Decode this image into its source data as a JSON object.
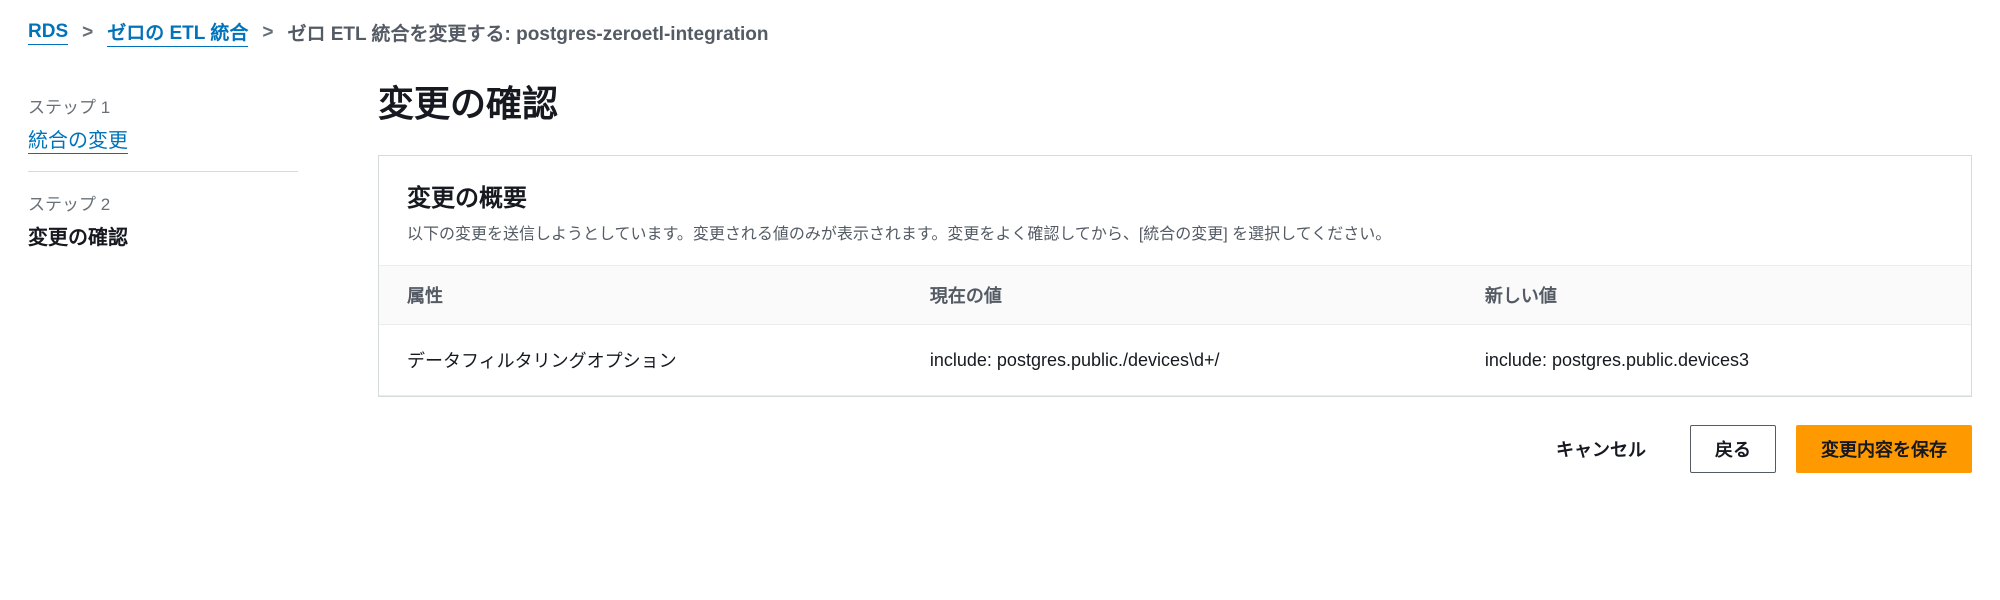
{
  "breadcrumb": {
    "items": [
      {
        "label": "RDS",
        "link": true
      },
      {
        "label": "ゼロの ETL 統合",
        "link": true
      },
      {
        "label": "ゼロ ETL 統合を変更する: postgres-zeroetl-integration",
        "link": false
      }
    ],
    "separator": ">"
  },
  "sidebar": {
    "steps": [
      {
        "label": "ステップ 1",
        "title": "統合の変更",
        "current": false
      },
      {
        "label": "ステップ 2",
        "title": "変更の確認",
        "current": true
      }
    ]
  },
  "main": {
    "title": "変更の確認",
    "panel": {
      "title": "変更の概要",
      "description": "以下の変更を送信しようとしています。変更される値のみが表示されます。変更をよく確認してから、[統合の変更] を選択してください。"
    },
    "table": {
      "headers": [
        "属性",
        "現在の値",
        "新しい値"
      ],
      "rows": [
        {
          "attribute": "データフィルタリングオプション",
          "current": "include: postgres.public./devices\\d+/",
          "new": "include: postgres.public.devices3"
        }
      ]
    },
    "actions": {
      "cancel": "キャンセル",
      "back": "戻る",
      "save": "変更内容を保存"
    }
  }
}
